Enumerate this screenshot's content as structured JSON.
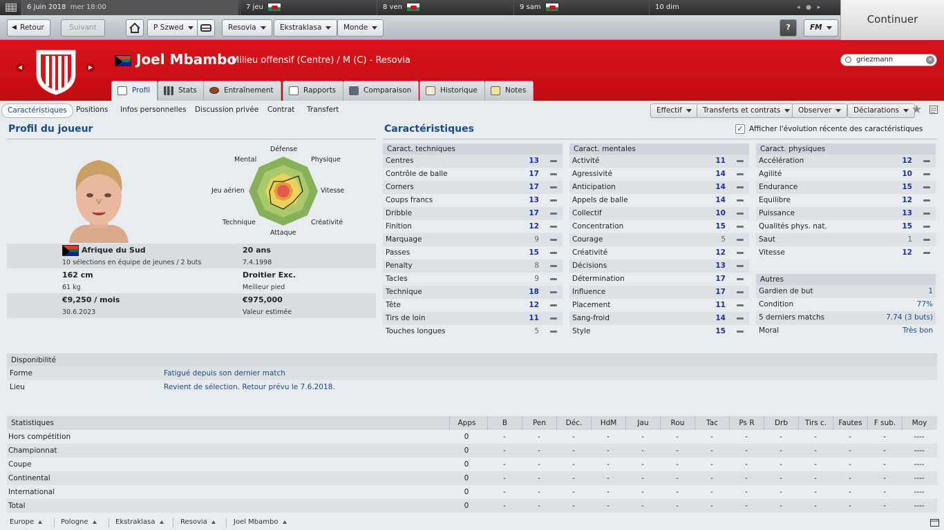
{
  "calendar": {
    "date": "6 juin 2018",
    "time": "mer 18:00",
    "days": [
      "7 jeu",
      "8 ven",
      "9 sam",
      "10 dim"
    ]
  },
  "continue_label": "Continuer",
  "toolbar": {
    "back": "Retour",
    "forward": "Suivant",
    "manager": "P Szwed",
    "club": "Resovia",
    "league": "Ekstraklasa",
    "world": "Monde",
    "help": "?",
    "fm": "FM"
  },
  "player": {
    "name": "Joel Mbambo",
    "role": "Milieu offensif (Centre) / M (C) - Resovia"
  },
  "search": {
    "value": "griezmann"
  },
  "tabs": [
    "Profil",
    "Stats",
    "Entraînement",
    "Rapports",
    "Comparaison",
    "Historique",
    "Notes"
  ],
  "subnav": [
    "Caractéristiques",
    "Positions",
    "Infos personnelles",
    "Discussion privée",
    "Contrat",
    "Transfert"
  ],
  "actions": [
    "Effectif",
    "Transferts et contrats",
    "Observer",
    "Déclarations"
  ],
  "profile": {
    "title": "Profil du joueur",
    "nation": "Afrique du Sud",
    "caps": "10 sélections en équipe de jeunes / 2 buts",
    "age": "20 ans",
    "dob": "7.4.1998",
    "height": "162 cm",
    "weight": "61 kg",
    "foot": "Droitier Exc.",
    "foot_label": "Meilleur pied",
    "wage": "€9,250 / mois",
    "contract_end": "30.6.2023",
    "value": "€975,000",
    "value_label": "Valeur estimée",
    "radar_labels": [
      "Défense",
      "Physique",
      "Vitesse",
      "Créativité",
      "Attaque",
      "Technique",
      "Jeu aérien",
      "Mental"
    ]
  },
  "attributes": {
    "title": "Caractéristiques",
    "show_recent": "Afficher l'évolution récente des caractéristiques",
    "technical_title": "Caract. techniques",
    "technical": [
      {
        "name": "Centres",
        "value": "13"
      },
      {
        "name": "Contrôle de balle",
        "value": "17"
      },
      {
        "name": "Corners",
        "value": "17"
      },
      {
        "name": "Coups francs",
        "value": "13"
      },
      {
        "name": "Dribble",
        "value": "17"
      },
      {
        "name": "Finition",
        "value": "12"
      },
      {
        "name": "Marquage",
        "value": "9"
      },
      {
        "name": "Passes",
        "value": "15"
      },
      {
        "name": "Penalty",
        "value": "8"
      },
      {
        "name": "Tacles",
        "value": "9"
      },
      {
        "name": "Technique",
        "value": "18"
      },
      {
        "name": "Tête",
        "value": "12"
      },
      {
        "name": "Tirs de loin",
        "value": "11"
      },
      {
        "name": "Touches longues",
        "value": "5"
      }
    ],
    "mental_title": "Caract. mentales",
    "mental": [
      {
        "name": "Activité",
        "value": "11"
      },
      {
        "name": "Agressivité",
        "value": "14"
      },
      {
        "name": "Anticipation",
        "value": "14"
      },
      {
        "name": "Appels de balle",
        "value": "14"
      },
      {
        "name": "Collectif",
        "value": "10"
      },
      {
        "name": "Concentration",
        "value": "15"
      },
      {
        "name": "Courage",
        "value": "5"
      },
      {
        "name": "Créativité",
        "value": "12"
      },
      {
        "name": "Décisions",
        "value": "13"
      },
      {
        "name": "Détermination",
        "value": "17"
      },
      {
        "name": "Influence",
        "value": "17"
      },
      {
        "name": "Placement",
        "value": "11"
      },
      {
        "name": "Sang-froid",
        "value": "14"
      },
      {
        "name": "Style",
        "value": "15"
      }
    ],
    "physical_title": "Caract. physiques",
    "physical": [
      {
        "name": "Accélération",
        "value": "12"
      },
      {
        "name": "Agilité",
        "value": "10"
      },
      {
        "name": "Endurance",
        "value": "15"
      },
      {
        "name": "Equilibre",
        "value": "12"
      },
      {
        "name": "Puissance",
        "value": "13"
      },
      {
        "name": "Qualités phys. nat.",
        "value": "15"
      },
      {
        "name": "Saut",
        "value": "1"
      },
      {
        "name": "Vitesse",
        "value": "12"
      }
    ],
    "other_title": "Autres",
    "other": [
      {
        "name": "Gardien de but",
        "value": "1"
      },
      {
        "name": "Condition",
        "value": "77%"
      },
      {
        "name": "5 derniers matchs",
        "value": "7.74 (3 buts)"
      },
      {
        "name": "Moral",
        "value": "Très bon"
      }
    ]
  },
  "availability": {
    "title": "Disponibilité",
    "rows": [
      {
        "key": "Forme",
        "value": "Fatigué depuis son dernier match"
      },
      {
        "key": "Lieu",
        "value": "Revient de sélection. Retour prévu le 7.6.2018."
      }
    ]
  },
  "stats": {
    "title": "Statistiques",
    "columns": [
      "Apps",
      "B",
      "Pen",
      "Déc.",
      "HdM",
      "Jau",
      "Rou",
      "Tac",
      "Ps R",
      "Drb",
      "Tirs c.",
      "Fautes",
      "F sub.",
      "Moy"
    ],
    "rows": [
      {
        "label": "Hors compétition",
        "cells": [
          "0",
          "-",
          "-",
          "-",
          "-",
          "-",
          "-",
          "-",
          "-",
          "-",
          "-",
          "-",
          "-",
          "----"
        ]
      },
      {
        "label": "Championnat",
        "cells": [
          "0",
          "-",
          "-",
          "-",
          "-",
          "-",
          "-",
          "-",
          "-",
          "-",
          "-",
          "-",
          "-",
          "----"
        ]
      },
      {
        "label": "Coupe",
        "cells": [
          "0",
          "-",
          "-",
          "-",
          "-",
          "-",
          "-",
          "-",
          "-",
          "-",
          "-",
          "-",
          "-",
          "----"
        ]
      },
      {
        "label": "Continental",
        "cells": [
          "0",
          "-",
          "-",
          "-",
          "-",
          "-",
          "-",
          "-",
          "-",
          "-",
          "-",
          "-",
          "-",
          "----"
        ]
      },
      {
        "label": "International",
        "cells": [
          "0",
          "-",
          "-",
          "-",
          "-",
          "-",
          "-",
          "-",
          "-",
          "-",
          "-",
          "-",
          "-",
          "----"
        ]
      },
      {
        "label": "Total",
        "cells": [
          "0",
          "-",
          "-",
          "-",
          "-",
          "-",
          "-",
          "-",
          "-",
          "-",
          "-",
          "-",
          "-",
          "----"
        ]
      }
    ]
  },
  "breadcrumb": [
    "Europe",
    "Pologne",
    "Ekstraklasa",
    "Resovia",
    "Joel Mbambo"
  ],
  "colors": {
    "header_red": "#d8131c",
    "accent_blue": "#1a4a8a",
    "value_blue": "#1b2fa0"
  }
}
